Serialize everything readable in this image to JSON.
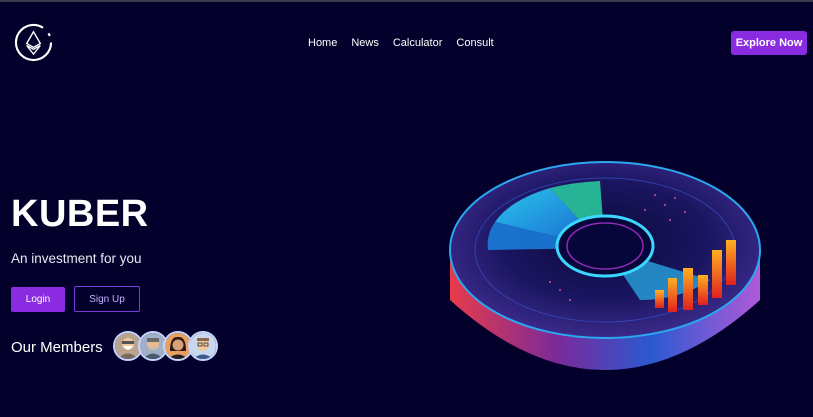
{
  "header": {
    "logo_icon": "ethereum-logo-icon",
    "nav": [
      "Home",
      "News",
      "Calculator",
      "Consult"
    ],
    "cta_label": "Explore Now"
  },
  "hero": {
    "title": "KUBER",
    "subtitle": "An investment for you",
    "login_label": "Login",
    "signup_label": "Sign Up",
    "members_label": "Our Members",
    "member_avatars": [
      "avatar-1",
      "avatar-2",
      "avatar-3",
      "avatar-4"
    ],
    "illustration": "financial-data-disc-illustration"
  },
  "colors": {
    "background": "#03012b",
    "accent": "#8a2be2",
    "text": "#ffffff"
  }
}
